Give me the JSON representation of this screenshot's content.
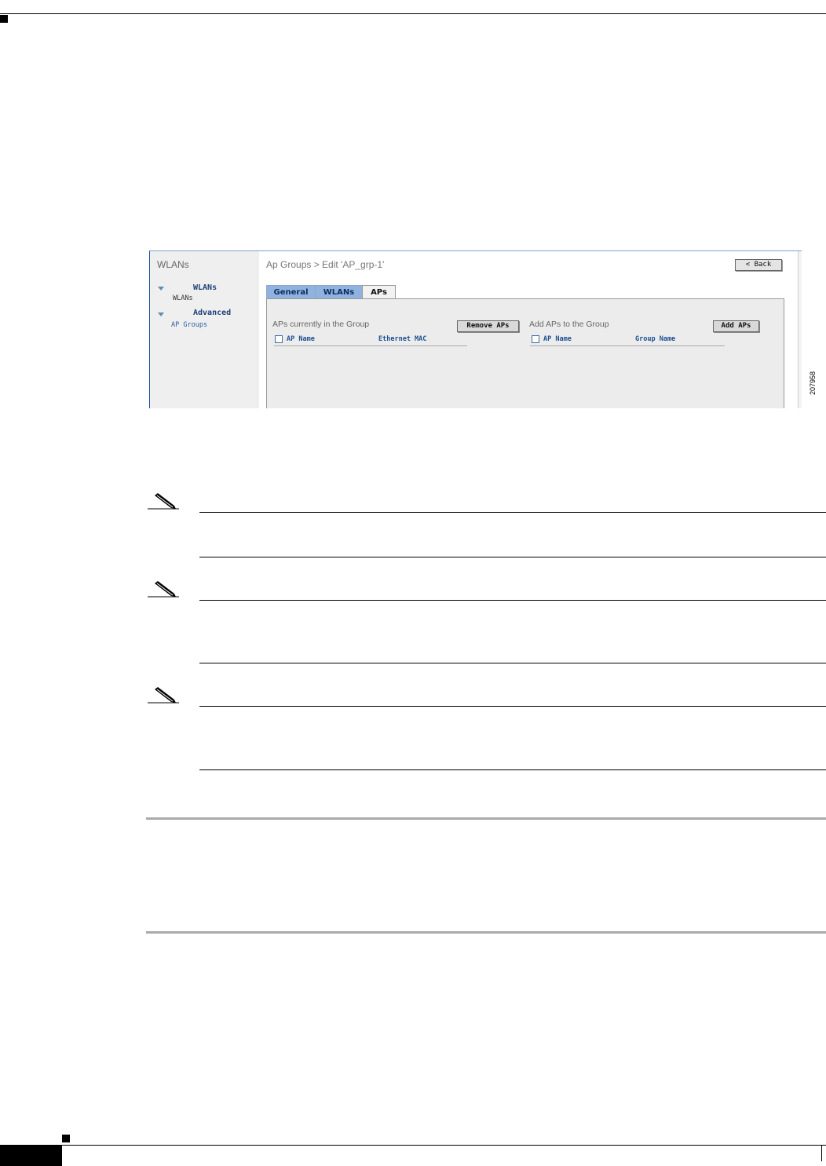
{
  "figure": {
    "sidebar": {
      "title": "WLANs",
      "sections": [
        {
          "heading": "WLANs",
          "item": "WLANs"
        },
        {
          "heading": "Advanced",
          "item": "AP Groups"
        }
      ]
    },
    "header": {
      "title": "Ap Groups > Edit  'AP_grp-1'",
      "back_label": "< Back"
    },
    "tabs": [
      {
        "label": "General",
        "active": false
      },
      {
        "label": "WLANs",
        "active": false
      },
      {
        "label": "APs",
        "active": true
      }
    ],
    "current_group": {
      "title": "APs currently in the Group",
      "button": "Remove APs",
      "columns": [
        "AP Name",
        "Ethernet MAC"
      ]
    },
    "add_group": {
      "title": "Add APs to the Group",
      "button": "Add APs",
      "columns": [
        "AP Name",
        "Group Name"
      ]
    },
    "figure_id": "207958"
  },
  "colors": {
    "tab_inactive": "#8fb3de",
    "tab_text": "#0e2d60",
    "link": "#2b5fa0",
    "panel": "#ececec"
  },
  "note_icons": [
    "pencil-icon",
    "pencil-icon",
    "pencil-icon"
  ]
}
